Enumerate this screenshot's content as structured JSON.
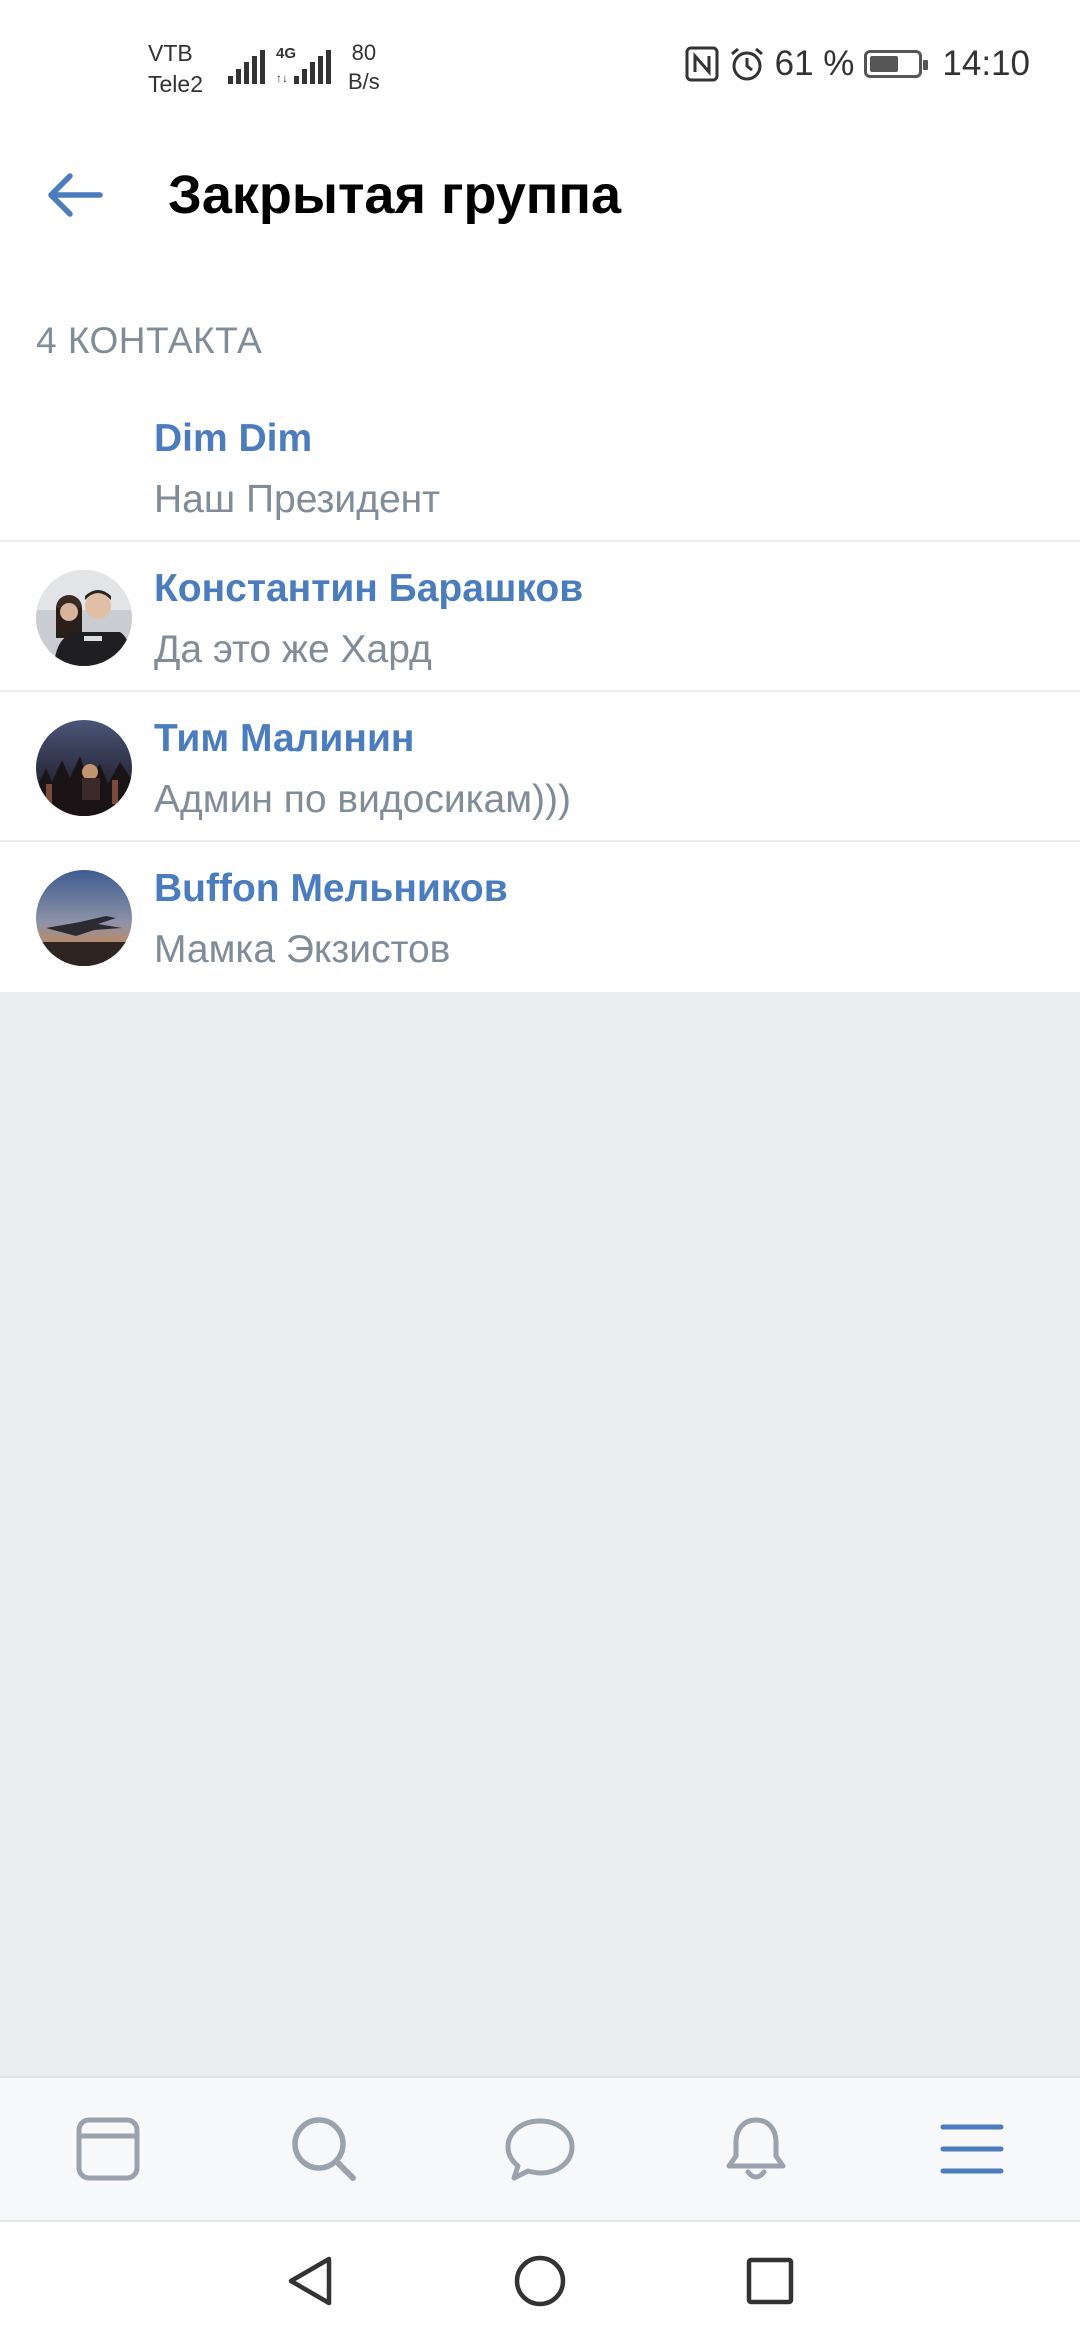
{
  "status_bar": {
    "carrier_1": "VTB",
    "carrier_2": "Tele2",
    "net_type": "4G",
    "speed_value": "80",
    "speed_unit": "B/s",
    "battery_percent": "61 %",
    "battery_level": 0.61,
    "time": "14:10"
  },
  "header": {
    "title": "Закрытая группа"
  },
  "contacts": {
    "section_title": "4 КОНТАКТА",
    "items": [
      {
        "name": "Dim Dim",
        "subtitle": "Наш Президент"
      },
      {
        "name": "Константин Барашков",
        "subtitle": "Да это же Хард"
      },
      {
        "name": "Тим Малинин",
        "subtitle": "Админ по видосикам)))"
      },
      {
        "name": "Buffon Мельников",
        "subtitle": "Мамка Экзистов"
      }
    ]
  },
  "tab_bar": {
    "items": [
      {
        "icon": "news-feed-icon",
        "active": false
      },
      {
        "icon": "search-icon",
        "active": false
      },
      {
        "icon": "messages-icon",
        "active": false
      },
      {
        "icon": "notifications-bell-icon",
        "active": false
      },
      {
        "icon": "menu-icon",
        "active": true
      }
    ]
  },
  "colors": {
    "accent": "#4a7cbe",
    "secondary_text": "#818c99",
    "background": "#ebedf0",
    "inactive_icon": "#99a2ad"
  }
}
